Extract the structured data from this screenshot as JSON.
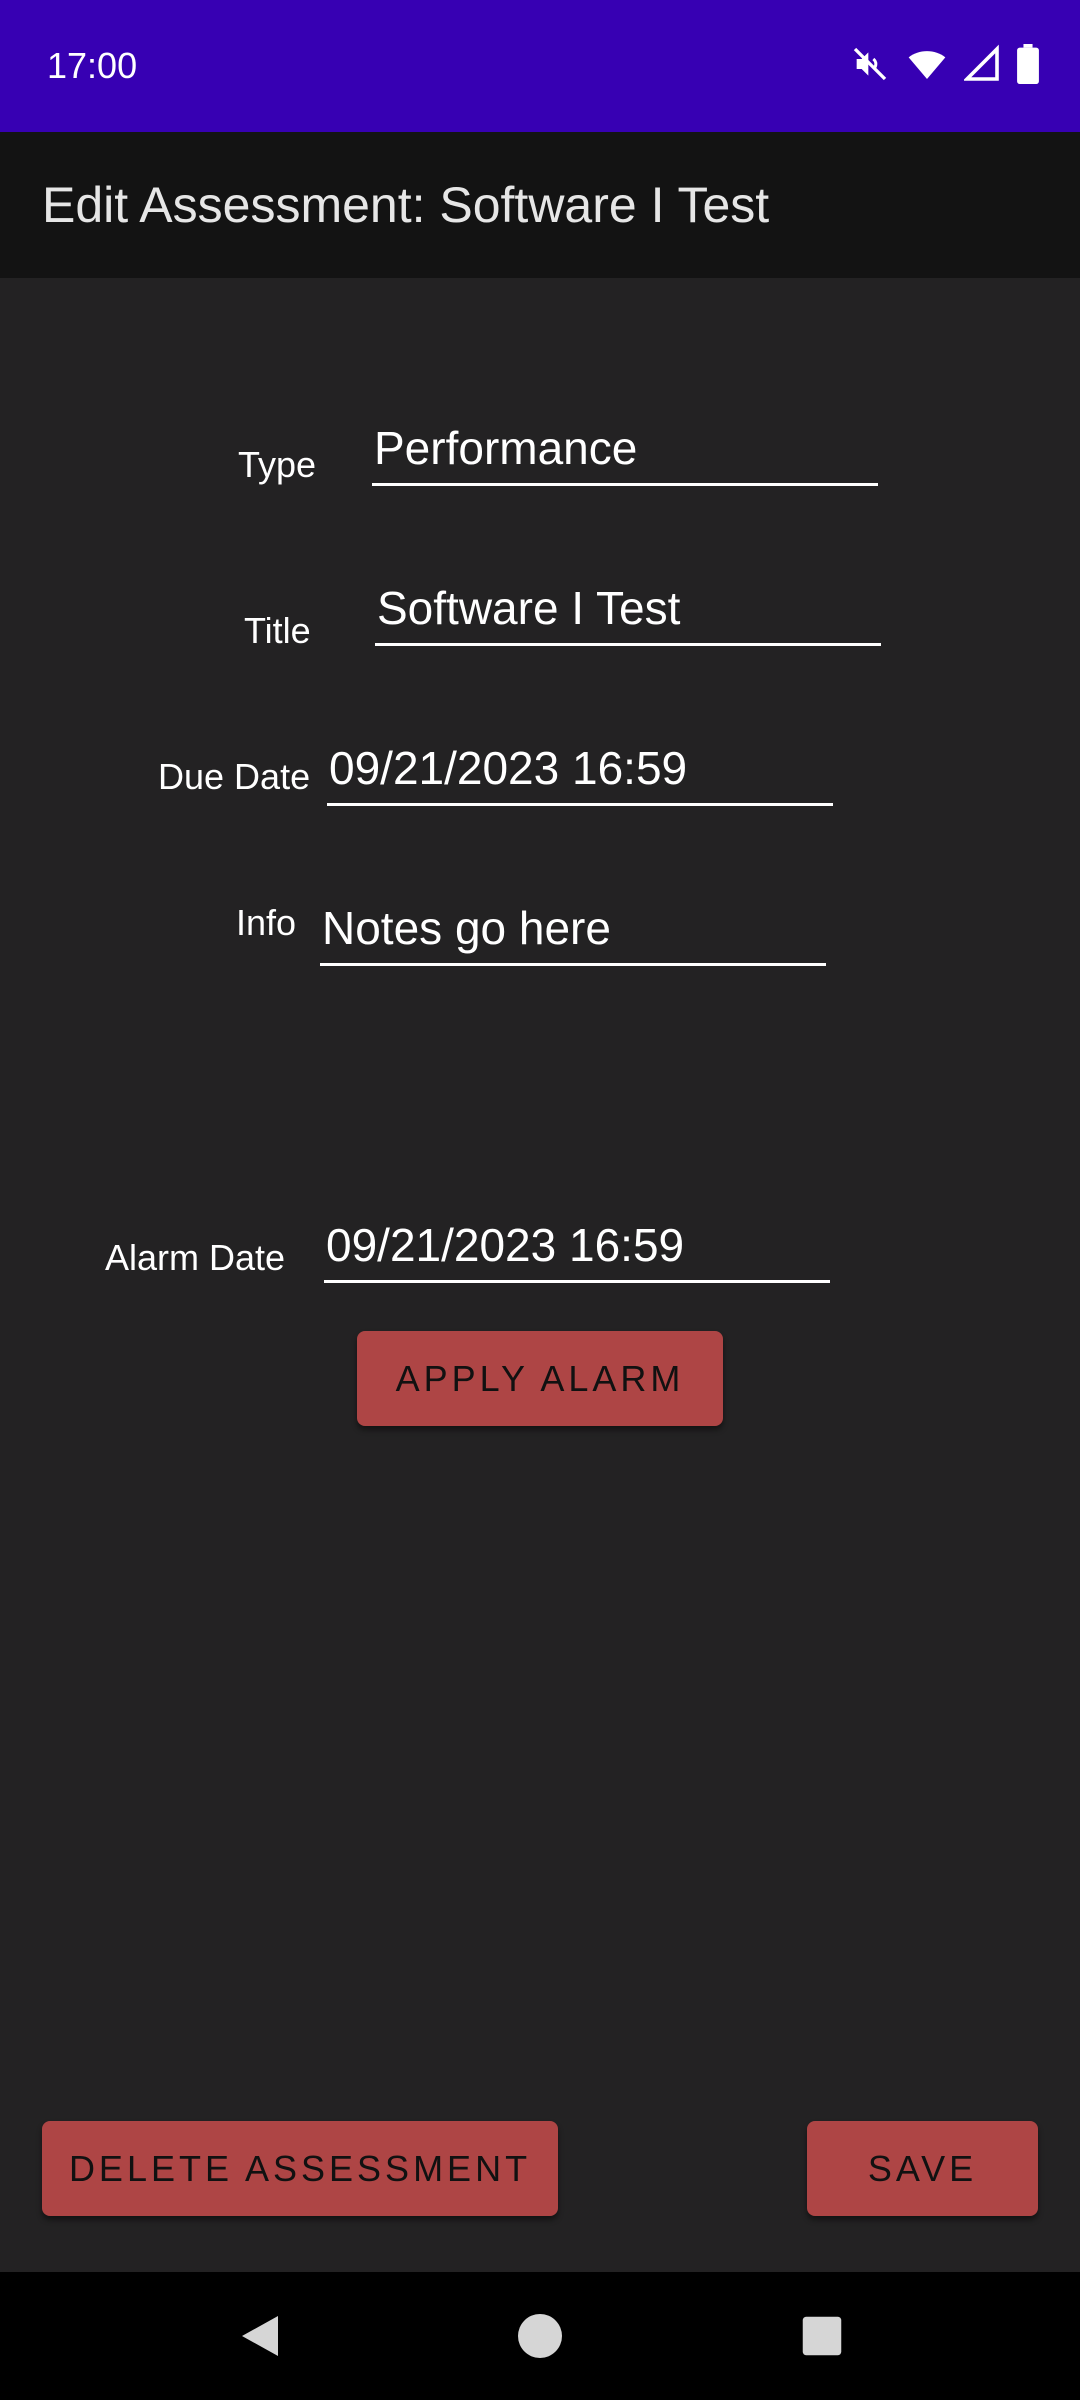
{
  "status_bar": {
    "time": "17:00",
    "icons": [
      "mute-icon",
      "wifi-icon",
      "signal-icon",
      "battery-icon"
    ]
  },
  "app_bar": {
    "title": "Edit Assessment: Software I Test"
  },
  "form": {
    "type": {
      "label": "Type",
      "value": "Performance"
    },
    "title": {
      "label": "Title",
      "value": "Software I Test"
    },
    "due_date": {
      "label": "Due Date",
      "value": "09/21/2023 16:59"
    },
    "info": {
      "label": "Info",
      "value": "Notes go here"
    },
    "alarm_date": {
      "label": "Alarm Date",
      "value": "09/21/2023 16:59"
    }
  },
  "buttons": {
    "apply_alarm": "APPLY ALARM",
    "delete_assessment": "DELETE ASSESSMENT",
    "save": "SAVE"
  },
  "colors": {
    "status_bar": "#3700B3",
    "app_bar": "#131313",
    "background": "#232223",
    "button": "#AE4545",
    "button_text": "#111111",
    "text": "#FFFFFF"
  },
  "nav_bar": {
    "icons": [
      "back-icon",
      "home-icon",
      "recents-icon"
    ]
  }
}
